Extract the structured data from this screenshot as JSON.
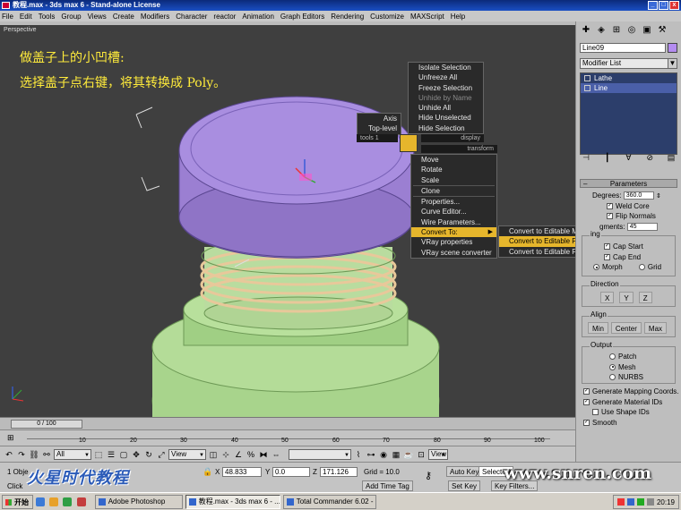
{
  "window": {
    "title": "教程.max - 3ds max 6 - Stand-alone License",
    "min": "_",
    "max": "□",
    "close": "x"
  },
  "menu": [
    "File",
    "Edit",
    "Tools",
    "Group",
    "Views",
    "Create",
    "Modifiers",
    "Character",
    "reactor",
    "Animation",
    "Graph Editors",
    "Rendering",
    "Customize",
    "MAXScript",
    "Help"
  ],
  "viewport": {
    "label": "Perspective",
    "note_line1": "做盖子上的小凹槽:",
    "note_line2": "选择盖子点右键，将其转换成 Poly。",
    "colors": {
      "bg": "#3f3f3f",
      "lid": "#a98ee0",
      "bottle": "#a8d48c",
      "ring": "#e8c89a"
    }
  },
  "quad_menu": {
    "display_items": [
      "Isolate Selection",
      "Unfreeze All",
      "Freeze Selection",
      "Unhide by Name",
      "Unhide All",
      "Hide Unselected",
      "Hide Selection"
    ],
    "display_header": "display",
    "tools_items": [
      "Axis",
      "Top-level"
    ],
    "tools_header": "tools 1",
    "transform_header": "transform",
    "transform_items": [
      "Move",
      "Rotate",
      "Scale",
      "Clone",
      "Properties...",
      "Curve Editor...",
      "Wire Parameters...",
      "Convert To:",
      "VRay properties",
      "VRay scene converter"
    ],
    "submenu_items": [
      "Convert to Editable Mesh",
      "Convert to Editable Poly",
      "Convert to Editable Patch"
    ],
    "submenu_arrow": "▶"
  },
  "command_panel": {
    "object_name": "Line09",
    "swatch_color": "#b48cf0",
    "modifier_list": "Modifier List",
    "stack": [
      "Lathe",
      "Line"
    ],
    "parameters_header": "Parameters",
    "degrees_label": "Degrees:",
    "degrees_value": "360.0",
    "weld_core": "Weld Core",
    "flip_normals": "Flip Normals",
    "segments_label": "gments:",
    "segments_value": "45",
    "capping_label": "ing",
    "cap_start": "Cap Start",
    "cap_end": "Cap End",
    "morph": "Morph",
    "grid": "Grid",
    "direction_label": "Direction",
    "dir_x": "X",
    "dir_y": "Y",
    "dir_z": "Z",
    "align_label": "Align",
    "align_min": "Min",
    "align_center": "Center",
    "align_max": "Max",
    "output_label": "Output",
    "out_patch": "Patch",
    "out_mesh": "Mesh",
    "out_nurbs": "NURBS",
    "gen_mapping": "Generate Mapping Coords.",
    "gen_material": "Generate Material IDs",
    "use_shape_ids": "Use Shape IDs",
    "smooth": "Smooth"
  },
  "timeline": {
    "slider": "0 / 100",
    "ticks": [
      "10",
      "20",
      "30",
      "40",
      "50",
      "60",
      "70",
      "80",
      "90",
      "100"
    ]
  },
  "bottom_tools": {
    "selection_filter": "All",
    "ref_coord": "View",
    "view_label": "View"
  },
  "status": {
    "objects": "1 Obje",
    "prompt": "Click",
    "x_label": "X",
    "x_value": "48.833",
    "y_label": "Y",
    "y_value": "0.0",
    "z_label": "Z",
    "z_value": "171.126",
    "grid": "Grid = 10.0",
    "add_time_tag": "Add Time Tag",
    "auto_key": "Auto Key",
    "selected": "Selected",
    "set_key": "Set Key",
    "key_filters": "Key Filters..."
  },
  "watermarks": {
    "left": "火星时代教程",
    "right": "www.snren.com"
  },
  "taskbar": {
    "start": "开始",
    "tasks": [
      "Adobe Photoshop",
      "教程.max - 3ds max 6 - ...",
      "Total Commander 6.02 - ..."
    ],
    "clock": "20:19"
  }
}
